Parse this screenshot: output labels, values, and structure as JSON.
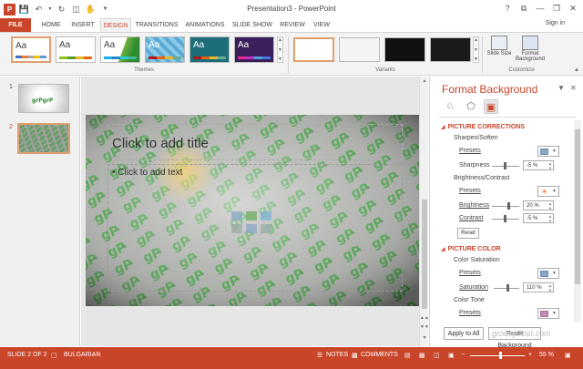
{
  "window": {
    "title": "Presentation3 - PowerPoint",
    "controls": [
      "?",
      "⧉",
      "—",
      "❐",
      "✕"
    ]
  },
  "tabs": {
    "file": "FILE",
    "items": [
      "HOME",
      "INSERT",
      "DESIGN",
      "TRANSITIONS",
      "ANIMATIONS",
      "SLIDE SHOW",
      "REVIEW",
      "VIEW"
    ],
    "active": "DESIGN",
    "signin": "Sign in"
  },
  "ribbon": {
    "themes_label": "Themes",
    "variants_label": "Variants",
    "customize_label": "Customize",
    "theme_sample": "Aa",
    "slide_size": "Slide Size",
    "format_background": "Format Background"
  },
  "thumbnails": {
    "items": [
      {
        "number": "1",
        "selected": false
      },
      {
        "number": "2",
        "selected": true
      }
    ]
  },
  "slide": {
    "title_placeholder": "Click to add title",
    "body_placeholder": "• Click to add text"
  },
  "format_pane": {
    "title": "Format Background",
    "picture_corrections": {
      "heading": "PICTURE CORRECTIONS",
      "sharpen_soften": "Sharpen/Soften",
      "presets_label": "Presets",
      "sharpness_label": "Sharpness",
      "sharpness_value": "-5 %",
      "sharpness_level": 0.45,
      "brightness_contrast": "Brightness/Contrast",
      "brightness_label": "Brightness",
      "brightness_value": "20 %",
      "brightness_level": 0.6,
      "contrast_label": "Contrast",
      "contrast_value": "-5 %",
      "contrast_level": 0.48,
      "reset": "Reset"
    },
    "picture_color": {
      "heading": "PICTURE COLOR",
      "color_saturation": "Color Saturation",
      "presets_label": "Presets",
      "saturation_label": "Saturation",
      "saturation_value": "110 %",
      "saturation_level": 0.55,
      "color_tone": "Color Tone",
      "tone_presets_label": "Presets"
    },
    "apply_all": "Apply to All",
    "reset_background": "Reset Background"
  },
  "status": {
    "slide_info": "SLIDE 2 OF 2",
    "language": "BULGARIAN",
    "notes": "NOTES",
    "comments": "COMMENTS",
    "zoom": "55 %",
    "zoom_level": 0.55
  },
  "watermark": "groovyPost.com",
  "colors": {
    "accent": "#c9452a",
    "green": "#2e8a2e"
  }
}
